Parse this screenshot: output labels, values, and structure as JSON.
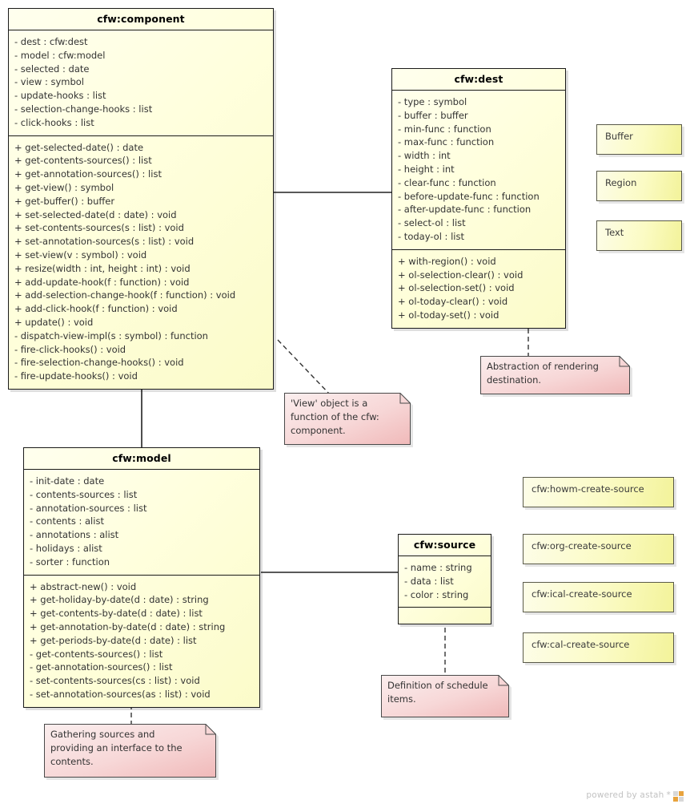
{
  "diagram": {
    "type": "uml-class-diagram",
    "watermark": {
      "text": "powered by astah",
      "star": "*"
    }
  },
  "classes": {
    "component": {
      "name": "cfw:component",
      "attributes": [
        "- dest : cfw:dest",
        "- model : cfw:model",
        "- selected : date",
        "- view : symbol",
        "- update-hooks : list",
        "- selection-change-hooks : list",
        "- click-hooks : list"
      ],
      "operations": [
        "+ get-selected-date() : date",
        "+ get-contents-sources() : list",
        "+ get-annotation-sources() : list",
        "+ get-view() : symbol",
        "+ get-buffer() : buffer",
        "+ set-selected-date(d : date) : void",
        "+ set-contents-sources(s : list) : void",
        "+ set-annotation-sources(s : list) : void",
        "+ set-view(v : symbol) : void",
        "+ resize(width : int, height : int) : void",
        "+ add-update-hook(f : function) : void",
        "+ add-selection-change-hook(f : function) : void",
        "+ add-click-hook(f : function) : void",
        "+ update() : void",
        "- dispatch-view-impl(s : symbol) : function",
        "- fire-click-hooks() : void",
        "- fire-selection-change-hooks() : void",
        "- fire-update-hooks() : void"
      ]
    },
    "dest": {
      "name": "cfw:dest",
      "attributes": [
        "- type : symbol",
        "- buffer : buffer",
        "- min-func : function",
        "- max-func : function",
        "- width : int",
        "- height : int",
        "- clear-func : function",
        "- before-update-func : function",
        "- after-update-func : function",
        "- select-ol : list",
        "- today-ol : list"
      ],
      "operations": [
        "+ with-region() : void",
        "+ ol-selection-clear() : void",
        "+ ol-selection-set() : void",
        "+ ol-today-clear() : void",
        "+ ol-today-set() : void"
      ]
    },
    "model": {
      "name": "cfw:model",
      "attributes": [
        "- init-date : date",
        "- contents-sources : list",
        "- annotation-sources : list",
        "- contents : alist",
        "- annotations : alist",
        "- holidays : alist",
        "- sorter : function"
      ],
      "operations": [
        "+ abstract-new() : void",
        "+ get-holiday-by-date(d : date) : string",
        "+ get-contents-by-date(d : date) : list",
        "+ get-annotation-by-date(d : date) : string",
        "+ get-periods-by-date(d : date) : list",
        "- get-contents-sources() : list",
        "- get-annotation-sources() : list",
        "- set-contents-sources(cs : list) : void",
        "- set-annotation-sources(as : list) : void"
      ]
    },
    "source": {
      "name": "cfw:source",
      "attributes": [
        "- name : string",
        "- data : list",
        "- color : string"
      ],
      "operations": []
    }
  },
  "simple_boxes": {
    "buffer": {
      "label": "Buffer"
    },
    "region": {
      "label": "Region"
    },
    "text": {
      "label": "Text"
    },
    "howm": {
      "label": "cfw:howm-create-source"
    },
    "org": {
      "label": "cfw:org-create-source"
    },
    "ical": {
      "label": "cfw:ical-create-source"
    },
    "cal": {
      "label": "cfw:cal-create-source"
    }
  },
  "notes": {
    "view_note": {
      "text": "'View' object is a\nfunction of the cfw:\ncomponent."
    },
    "dest_note": {
      "text": "Abstraction of rendering\ndestination."
    },
    "source_note": {
      "text": "Definition of schedule\nitems."
    },
    "model_note": {
      "text": "Gathering sources and\nproviding an interface to the\ncontents."
    }
  },
  "colors": {
    "class_fill": "#ffffdd",
    "class_fill_dark": "#fbfbc9",
    "class_border": "#1a1a1a",
    "simple_fill": "#f3f39a",
    "note_fill": "#f6cfcf",
    "note_border": "#4a4a4a",
    "line": "#222222",
    "watermark": "#c2c2c2"
  }
}
